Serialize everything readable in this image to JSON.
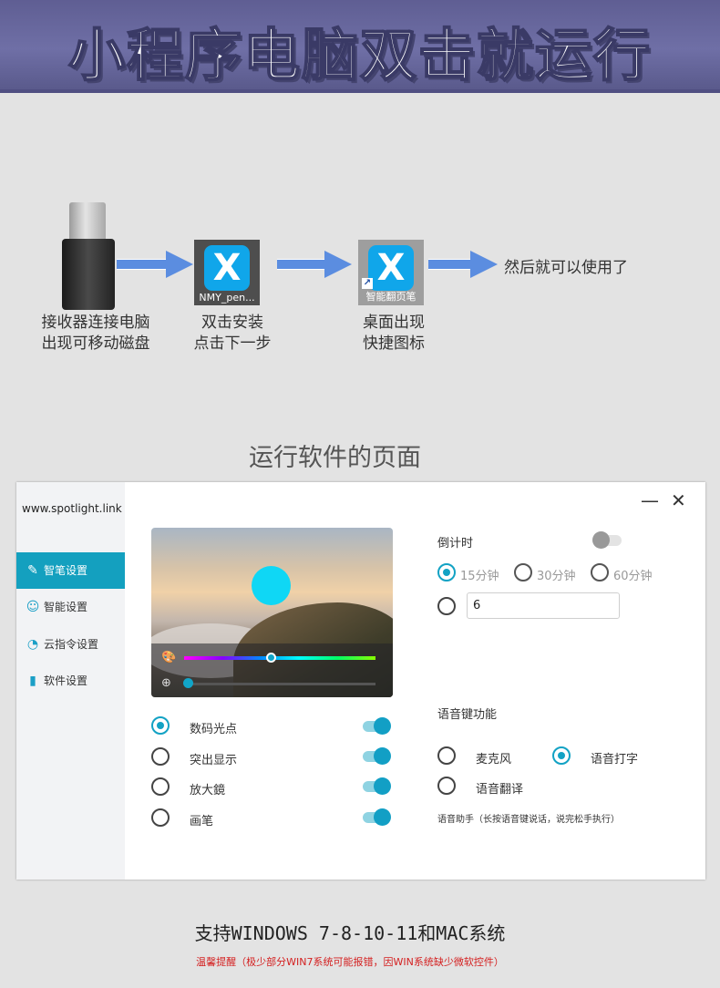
{
  "banner": {
    "title": "小程序电脑双击就运行"
  },
  "flow": {
    "step1": {
      "line1": "接收器连接电脑",
      "line2": "出现可移动磁盘"
    },
    "step2": {
      "icon_caption": "NMY_pen...",
      "line1": "双击安装",
      "line2": "点击下一步"
    },
    "step3": {
      "icon_caption": "智能翻页笔",
      "line1": "桌面出现",
      "line2": "快捷图标"
    },
    "step4": {
      "text": "然后就可以使用了"
    }
  },
  "section_title": "运行软件的页面",
  "window": {
    "brand": "www.spotlight.link",
    "controls": {
      "minimize": "—",
      "close": "✕"
    },
    "nav": [
      {
        "label": "智笔设置",
        "icon": "pen-icon",
        "active": true
      },
      {
        "label": "智能设置",
        "icon": "robot-icon",
        "active": false
      },
      {
        "label": "云指令设置",
        "icon": "signal-icon",
        "active": false
      },
      {
        "label": "软件设置",
        "icon": "bookmark-icon",
        "active": false
      }
    ],
    "preview": {
      "color_level": 0.45,
      "zoom_level": 0.0
    },
    "modes": [
      {
        "label": "数码光点",
        "selected": true,
        "enabled": true
      },
      {
        "label": "突出显示",
        "selected": false,
        "enabled": true
      },
      {
        "label": "放大鏡",
        "selected": false,
        "enabled": true
      },
      {
        "label": "画笔",
        "selected": false,
        "enabled": true
      }
    ],
    "countdown": {
      "label": "倒计时",
      "enabled": false,
      "options": [
        "15分钟",
        "30分钟",
        "60分钟"
      ],
      "selected": "15分钟",
      "custom_value": "6"
    },
    "voice": {
      "label": "语音键功能",
      "options": [
        "麦克风",
        "语音打字",
        "语音翻译"
      ],
      "selected": "语音打字",
      "hint": "语音助手（长按语音键说话，说完松手执行）"
    }
  },
  "footer": {
    "support": "支持WINDOWS 7-8-10-11和MAC系统",
    "warning": "温馨提醒（极少部分WIN7系统可能报错，因WIN系统缺少微软控件）"
  },
  "colors": {
    "accent": "#14a0bf",
    "banner": "#66659c",
    "arrow": "#5b8de0",
    "warning": "#d42020"
  }
}
